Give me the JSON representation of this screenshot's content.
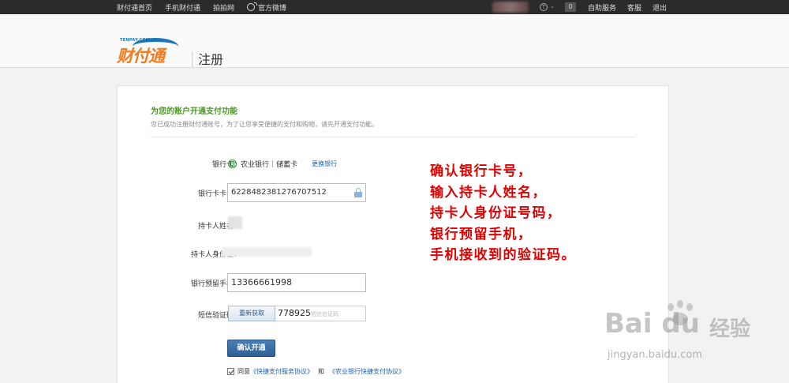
{
  "topbar": {
    "nav": [
      "财付通首页",
      "手机财付通",
      "拍拍网",
      "官方微博"
    ],
    "message_count": "0",
    "right": [
      "自助服务",
      "客服",
      "退出"
    ],
    "caret": "⌄"
  },
  "header": {
    "logo_small": "TENPAY.COM",
    "logo_text": "财付通",
    "page_title": "注册"
  },
  "form": {
    "section_title": "为您的账户开通支付功能",
    "section_subtitle": "您已成功注册财付通账号，为了让您享受便捷的支付和购物，请先开通支付功能。",
    "bank_label": "银行卡：",
    "bank_name": "农业银行",
    "card_type": "储蓄卡",
    "change_bank": "更换银行",
    "card_number_label": "银行卡卡号：",
    "card_number": "6228482381276707512",
    "holder_name_label": "持卡人姓名：",
    "holder_id_label": "持卡人身份证：",
    "phone_label": "银行预留手机：",
    "phone": "13366661998",
    "sms_label": "短信验证码：",
    "sms_button": "重新获取",
    "sms_code": "778925",
    "sms_placeholder": "短信验证码",
    "confirm_button": "确认开通",
    "agree_prefix": "同意",
    "agreement_1": "《快捷支付服务协议》",
    "agree_and": "和",
    "agreement_2": "《农业银行快捷支付协议》"
  },
  "annotation": [
    "确认银行卡号，",
    "输入持卡人姓名，",
    "持卡人身份证号码，",
    "银行预留手机，",
    "手机接收到的验证码。"
  ],
  "watermark": {
    "brand": "Bai du",
    "product": "经验",
    "url": "jingyan.baidu.com"
  },
  "colors": {
    "topbar": "#2b2b2b",
    "logo_orange": "#f37b1d",
    "logo_blue": "#1976b8",
    "section_title": "#4a9a20",
    "link": "#1a62b0",
    "annotation": "#e00000"
  }
}
